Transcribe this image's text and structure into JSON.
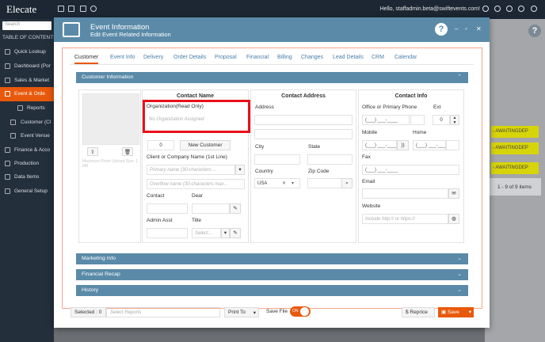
{
  "app": {
    "brand": "Elecate",
    "hello": "Hello, staffadmin.beta@swiftevents.com!",
    "search_placeholder": "Search",
    "toc": "TABLE OF CONTENTS",
    "help": "?"
  },
  "sidebar": {
    "items": [
      {
        "label": "Quick Lookup"
      },
      {
        "label": "Dashboard (Por"
      },
      {
        "label": "Sales & Market"
      },
      {
        "label": "Event & Orde"
      },
      {
        "label": "Reports"
      },
      {
        "label": "Customer (Cl"
      },
      {
        "label": "Event Venue"
      },
      {
        "label": "Finance & Acco"
      },
      {
        "label": "Production"
      },
      {
        "label": "Data Items"
      },
      {
        "label": "General Setup"
      }
    ]
  },
  "background": {
    "status_rows": [
      "- AWAITINGDEP",
      "- AWAITINGDEP",
      "- AWAITINGDEP"
    ],
    "pagination": "1 - 9 of 9 items"
  },
  "modal": {
    "title": "Event Information",
    "subtitle": "Edit Event Related Information",
    "help": "?",
    "tabs": [
      {
        "label": "Customer"
      },
      {
        "label": "Event Info"
      },
      {
        "label": "Delivery"
      },
      {
        "label": "Order Details"
      },
      {
        "label": "Proposal"
      },
      {
        "label": "Financial"
      },
      {
        "label": "Billing"
      },
      {
        "label": "Changes"
      },
      {
        "label": "Lead Details"
      },
      {
        "label": "CRM"
      },
      {
        "label": "Calendar"
      }
    ],
    "sections": {
      "customer": "Customer Information",
      "marketing": "Marketing Info",
      "financial": "Financial Recap",
      "history": "History"
    },
    "contact_name": {
      "heading": "Contact Name",
      "org_label": "Organization(Read Only)",
      "org_placeholder": "No Organization Assigned",
      "count": "0",
      "new_customer": "New Customer",
      "client_label": "Client or Company Name (1st Line)",
      "primary_placeholder": "Primary name (30-characters ...",
      "overflow_placeholder": "Overflow name (30-characters max...",
      "contact_label": "Contact",
      "dear_label": "Dear",
      "admin_label": "Admin Asst",
      "title_label": "Title",
      "title_select": "Select...",
      "photo_caption": "Maximum Photo Upload Size: 1 MB"
    },
    "contact_address": {
      "heading": "Contact Address",
      "address_label": "Address",
      "city_label": "City",
      "state_label": "State",
      "country_label": "Country",
      "zip_label": "Zip Code",
      "country_value": "USA"
    },
    "contact_info": {
      "heading": "Contact Info",
      "office_label": "Office or Primary Phone",
      "ext_label": "Ext",
      "ext_value": "0",
      "mobile_label": "Mobile",
      "home_label": "Home",
      "fax_label": "Fax",
      "email_label": "Email",
      "website_label": "Website",
      "website_placeholder": "Include http:// or https://",
      "phone_mask": "(___) ___-____"
    },
    "footer": {
      "selected": "Selected : 0",
      "select_reports": "Select Reports",
      "print_to": "Print To",
      "save_file": "Save File",
      "toggle": "ON",
      "reprice": "Reprice",
      "save": "Save"
    }
  }
}
